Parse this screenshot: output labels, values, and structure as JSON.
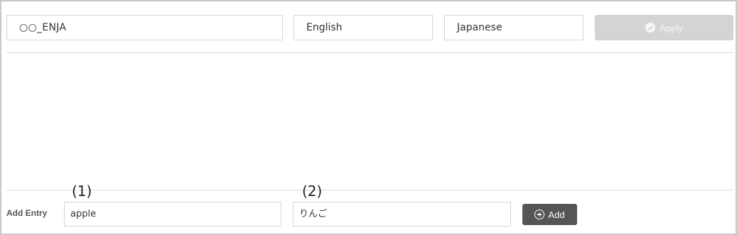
{
  "dictionary": {
    "name_value": "○○_ENJA",
    "source_language": "English",
    "target_language": "Japanese",
    "apply_label": "Apply"
  },
  "add_entry": {
    "label": "Add Entry",
    "marker_source": "(1)",
    "marker_target": "(2)",
    "source_value": "apple",
    "target_value": "りんご",
    "add_label": "Add"
  },
  "colors": {
    "apply_disabled_bg": "#d4d4d4",
    "add_button_bg": "#555555",
    "border": "#d6d6d6"
  },
  "icons": {
    "apply": "check-circle-icon",
    "add": "plus-circle-icon"
  }
}
